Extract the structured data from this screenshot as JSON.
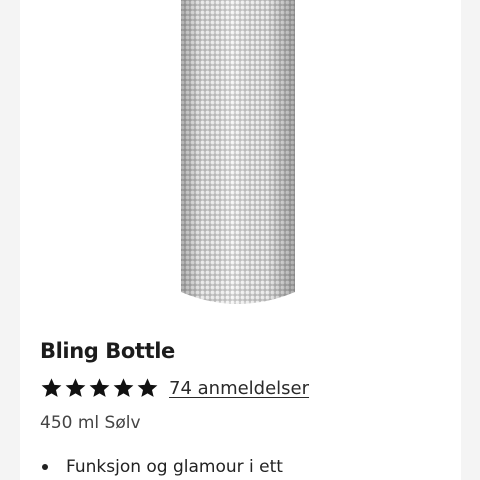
{
  "product": {
    "name": "Bling Bottle",
    "image_alt": "bottle-image",
    "rating": {
      "stars": 5,
      "max": 5,
      "reviews_label": "74 anmeldelser"
    },
    "variant": "450 ml Sølv",
    "features": [
      "Funksjon og glamour i ett"
    ]
  },
  "colors": {
    "star": "#111111",
    "bottle": "#d9d9d9",
    "card": "#ffffff",
    "background": "#f4f4f4"
  }
}
